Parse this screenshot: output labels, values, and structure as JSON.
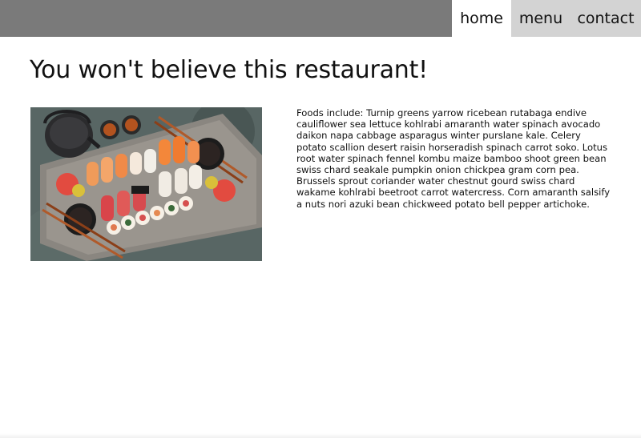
{
  "nav": {
    "items": [
      {
        "label": "home"
      },
      {
        "label": "menu"
      },
      {
        "label": "contact"
      }
    ]
  },
  "main": {
    "title": "You won't believe this restaurant!",
    "description": "Foods include: Turnip greens yarrow ricebean rutabaga endive cauliflower sea lettuce kohlrabi amaranth water spinach avocado daikon napa cabbage asparagus winter purslane kale. Celery potato scallion desert raisin horseradish spinach carrot soko. Lotus root water spinach fennel kombu maize bamboo shoot green bean swiss chard seakale pumpkin onion chickpea gram corn pea. Brussels sprout coriander water chestnut gourd swiss chard wakame kohlrabi beetroot carrot watercress. Corn amaranth salsify a nuts nori azuki bean chickweed potato bell pepper artichoke."
  },
  "colors": {
    "header_bg": "#7a7a7a",
    "nav_bg": "#d3d3d3",
    "nav_active_bg": "#ffffff"
  }
}
